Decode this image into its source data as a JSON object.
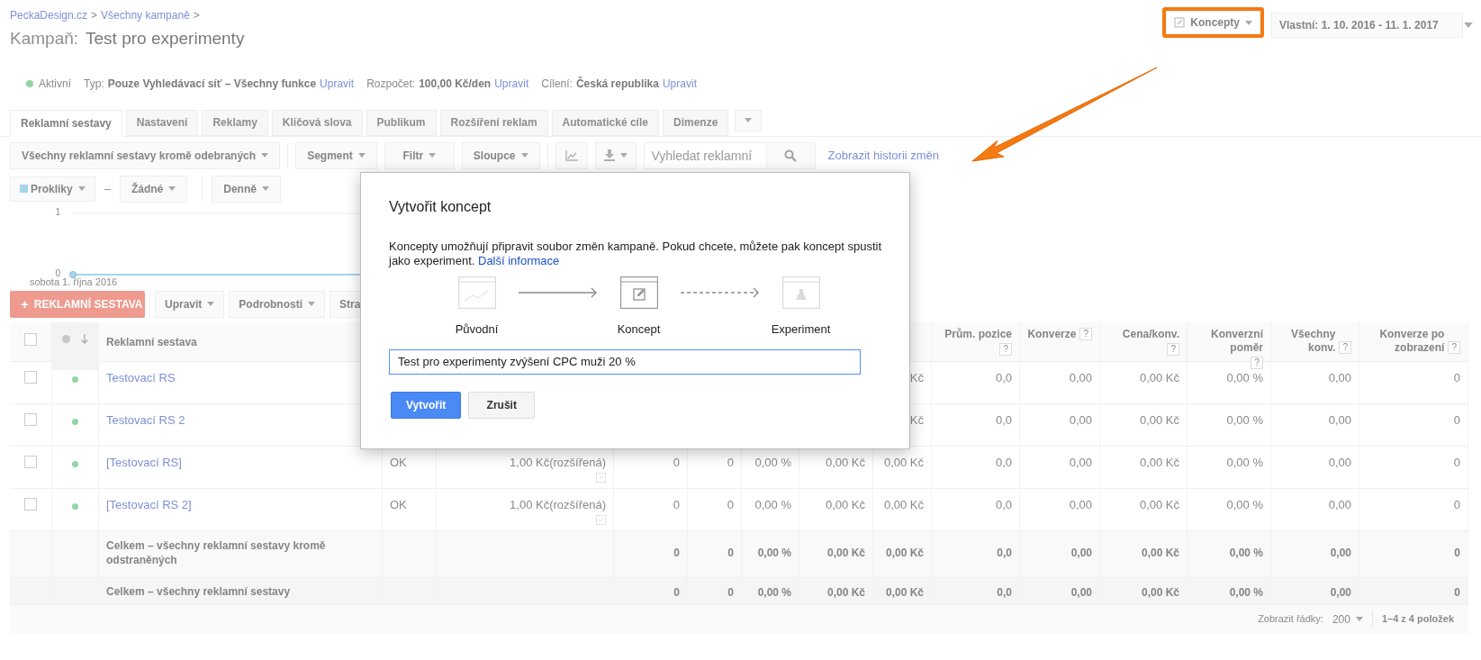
{
  "breadcrumb": [
    {
      "label": "PeckaDesign.cz"
    },
    {
      "label": "Všechny kampaně"
    }
  ],
  "breadcrumb_separator": ">",
  "title": {
    "prefix": "Kampaň:",
    "name": "Test pro experimenty"
  },
  "top_buttons": [
    {
      "kind": "drafts",
      "label": "Koncepty",
      "highlighted": true
    },
    {
      "kind": "date",
      "label": "Vlastní: 1. 10. 2016 - 11. 1. 2017",
      "highlighted": false
    }
  ],
  "status": {
    "label": "Aktivní",
    "active": true
  },
  "summary": [
    {
      "label": "Typ:",
      "value": "Pouze Vyhledávací síť – Všechny funkce",
      "link": "Upravit"
    },
    {
      "label": "Rozpočet:",
      "value": "100,00 Kč/den",
      "link": "Upravit"
    },
    {
      "label": "Cílení:",
      "value": "Česká republika",
      "link": "Upravit"
    }
  ],
  "tabs": [
    {
      "label": "Reklamní sestavy",
      "selected": true
    },
    {
      "label": "Nastavení",
      "selected": false
    },
    {
      "label": "Reklamy",
      "selected": false
    },
    {
      "label": "Klíčová slova",
      "selected": false
    },
    {
      "label": "Publikum",
      "selected": false
    },
    {
      "label": "Rozšíření reklam",
      "selected": false
    },
    {
      "label": "Automatické cíle",
      "selected": false
    },
    {
      "label": "Dimenze",
      "selected": false
    }
  ],
  "toolbar": {
    "filter": "Všechny reklamní sestavy kromě odebraných",
    "buttons": [
      "Segment",
      "Filtr",
      "Sloupce"
    ],
    "search": {
      "placeholder": "Vyhledat reklamní"
    },
    "history_link": "Zobrazit historii změn"
  },
  "chart_controls": {
    "separator": "–",
    "metric2": "Žádné",
    "period": "Denně"
  },
  "chart_data": {
    "type": "line",
    "ylim": [
      0,
      1
    ],
    "yticks": [
      0,
      1
    ],
    "categories": [
      "sobota 1. října 2016"
    ],
    "series": [
      {
        "name": "Prokliky",
        "color": "#a8d4ec",
        "marker": "circle",
        "values": [
          0
        ]
      }
    ]
  },
  "actions": [
    {
      "kind": "primary",
      "icon_text": "+",
      "label": "REKLAMNÍ SESTAVA"
    },
    {
      "kind": "dropdown",
      "label": "Upravit"
    },
    {
      "kind": "dropdown",
      "label": "Podrobnosti"
    },
    {
      "kind": "dropdown",
      "label": "Stra"
    }
  ],
  "table": {
    "select_all_checked": false,
    "name_column": "Reklamní sestava",
    "columns": [
      {},
      {},
      {},
      {},
      {},
      {},
      {},
      {
        "label": "Prům. pozice",
        "help": "?"
      },
      {
        "label": "Konverze",
        "help": "?"
      },
      {
        "label": "Cena/konv.",
        "help": "?"
      },
      {
        "label": "Konverzní poměr",
        "help": "?"
      },
      {
        "label": "Všechny konv.",
        "help": "?"
      },
      {
        "label": "Konverze po zobrazení",
        "help": "?"
      }
    ],
    "rows": [
      {
        "kind": "item",
        "checked": false,
        "name": "Testovací RS",
        "cells": [
          null,
          null,
          null,
          null,
          null,
          null,
          "Kč",
          "0,0",
          "0,00",
          "0,00 Kč",
          "0,00 %",
          "0,00",
          "0"
        ]
      },
      {
        "kind": "item",
        "checked": false,
        "name": "Testovací RS 2",
        "cells": [
          null,
          null,
          null,
          null,
          null,
          null,
          "Kč",
          "0,0",
          "0,00",
          "0,00 Kč",
          "0,00 %",
          "0,00",
          "0"
        ]
      },
      {
        "kind": "item",
        "checked": false,
        "name": "[Testovací RS]",
        "cells": [
          "OK",
          "1,00 Kč(rozšířená)",
          "0",
          "0",
          "0,00 %",
          "0,00 Kč",
          "0,00 Kč",
          "0,0",
          "0,00",
          "0,00 Kč",
          "0,00 %",
          "0,00",
          "0"
        ]
      },
      {
        "kind": "item",
        "checked": false,
        "name": "[Testovací RS 2]",
        "cells": [
          "OK",
          "1,00 Kč(rozšířená)",
          "0",
          "0",
          "0,00 %",
          "0,00 Kč",
          "0,00 Kč",
          "0,0",
          "0,00",
          "0,00 Kč",
          "0,00 %",
          "0,00",
          "0"
        ]
      },
      {
        "kind": "total",
        "name": "Celkem – všechny reklamní sestavy kromě odstraněných",
        "cells": [
          null,
          null,
          "0",
          "0",
          "0,00 %",
          "0,00 Kč",
          "0,00 Kč",
          "0,0",
          "0,00",
          "0,00 Kč",
          "0,00 %",
          "0,00",
          "0"
        ]
      },
      {
        "kind": "grand_total",
        "name": "Celkem – všechny reklamní sestavy",
        "cells": [
          null,
          null,
          "0",
          "0",
          "0,00 %",
          "0,00 Kč",
          "0,00 Kč",
          "0,0",
          "0,00",
          "0,00 Kč",
          "0,00 %",
          "0,00",
          "0"
        ]
      }
    ],
    "footer": {
      "rows_label": "Zobrazit řádky:",
      "rows_value": "200",
      "range": "1–4 z 4 položek"
    }
  },
  "dialog": {
    "title": "Vytvořit koncept",
    "text": "Koncepty umožňují připravit soubor změn kampaně. Pokud chcete, můžete pak koncept spustit jako experiment.",
    "link": "Další informace",
    "steps": [
      {
        "kind": "original",
        "label": "Původní",
        "selected": false
      },
      {
        "kind": "draft",
        "label": "Koncept",
        "selected": true
      },
      {
        "kind": "experiment",
        "label": "Experiment",
        "selected": false
      }
    ],
    "connectors": [
      {
        "kind": "solid"
      },
      {
        "kind": "dashed"
      }
    ],
    "input": {
      "value": "Test pro experimenty zvýšení CPC muži 20 %",
      "focused": true
    },
    "buttons": [
      {
        "kind": "primary",
        "label": "Vytvořit"
      },
      {
        "kind": "secondary",
        "label": "Zrušit"
      }
    ]
  },
  "callout_arrow": true
}
